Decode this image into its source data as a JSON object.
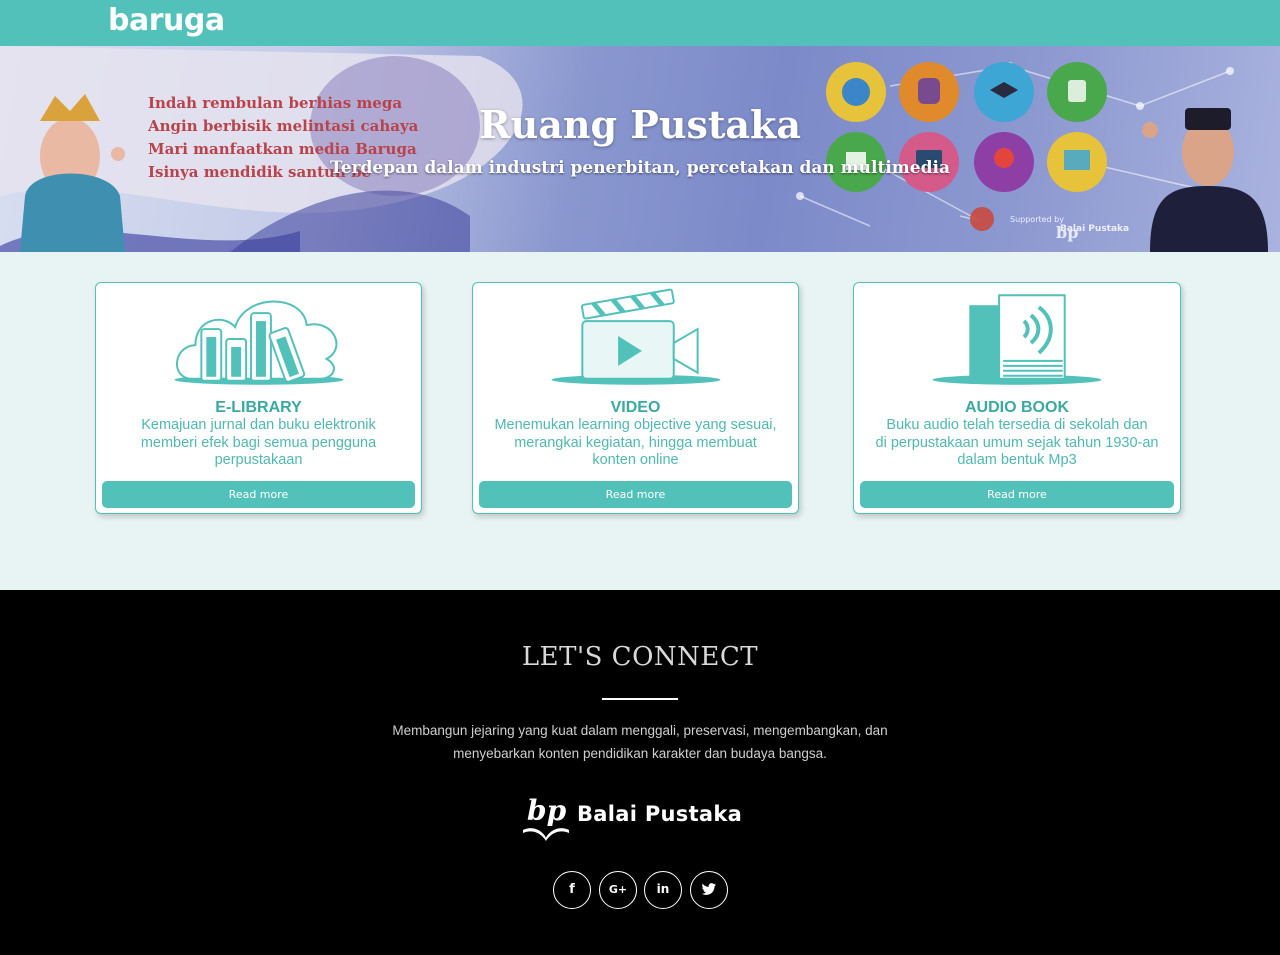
{
  "header": {
    "logo_text": "baruga",
    "brand_color": "#52c1b9"
  },
  "hero": {
    "poem": [
      "Indah rembulan berhias mega",
      "Angin berbisik melintasi cahaya",
      "Mari manfaatkan media Baruga",
      "Isinya mendidik santun be"
    ],
    "title": "Ruang Pustaka",
    "subtitle": "Terdepan dalam industri penerbitan, percetakan dan multimedia",
    "supported_by": "Balai Pustaka"
  },
  "cards": [
    {
      "icon": "library-cloud-icon",
      "title": "E-LIBRARY",
      "desc": [
        "Kemajuan jurnal dan buku elektronik",
        "memberi efek bagi semua pengguna",
        "perpustakaan"
      ],
      "button": "Read more"
    },
    {
      "icon": "video-camera-icon",
      "title": "VIDEO",
      "desc": [
        "Menemukan learning objective yang sesuai,",
        "merangkai kegiatan, hingga membuat",
        "konten online"
      ],
      "button": "Read more"
    },
    {
      "icon": "audio-book-icon",
      "title": "AUDIO BOOK",
      "desc": [
        "Buku audio telah tersedia di sekolah dan",
        "di perpustakaan umum sejak tahun 1930-an",
        "dalam bentuk Mp3"
      ],
      "button": "Read more"
    }
  ],
  "footer": {
    "title": "LET'S CONNECT",
    "text": [
      "Membangun jejaring yang kuat dalam menggali, preservasi, mengembangkan, dan",
      "menyebarkan konten pendidikan karakter dan budaya bangsa."
    ],
    "brand": "Balai Pustaka",
    "brand_mark": "bp",
    "social": [
      {
        "icon": "facebook-icon",
        "glyph": "f"
      },
      {
        "icon": "google-plus-icon",
        "glyph": "G+"
      },
      {
        "icon": "linkedin-icon",
        "glyph": "in"
      },
      {
        "icon": "twitter-icon",
        "glyph": "🐦"
      }
    ]
  }
}
